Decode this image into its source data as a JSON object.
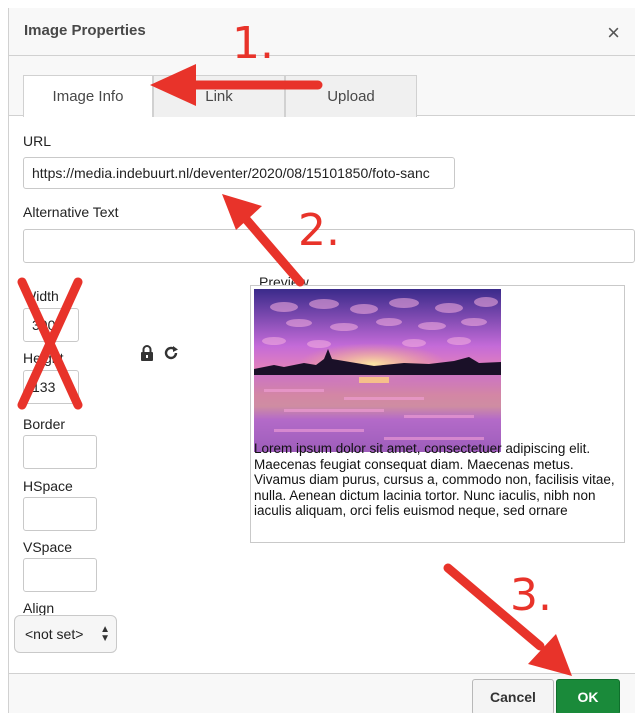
{
  "dialog": {
    "title": "Image Properties",
    "close_glyph": "×"
  },
  "tabs": [
    {
      "label": "Image Info",
      "active": true
    },
    {
      "label": "Link",
      "active": false
    },
    {
      "label": "Upload",
      "active": false
    }
  ],
  "form": {
    "url_label": "URL",
    "url_value": "https://media.indebuurt.nl/deventer/2020/08/15101850/foto-sanc",
    "alt_label": "Alternative Text",
    "alt_value": "",
    "width_label": "Width",
    "width_value": "300",
    "height_label": "Height",
    "height_value": "133",
    "border_label": "Border",
    "hspace_label": "HSpace",
    "vspace_label": "VSpace",
    "align_label": "Align",
    "align_value": "<not set>"
  },
  "preview": {
    "label": "Preview",
    "text": "Lorem ipsum dolor sit amet, consectetuer adipiscing elit. Maecenas feugiat consequat diam. Maecenas metus. Vivamus diam purus, cursus a, commodo non, facilisis vitae, nulla. Aenean dictum lacinia tortor. Nunc iaculis, nibh non iaculis aliquam, orci felis euismod neque, sed ornare"
  },
  "buttons": {
    "cancel_label": "Cancel",
    "ok_label": "OK"
  },
  "annotations": {
    "step1": "1.",
    "step2": "2.",
    "step3": "3."
  },
  "icons": [
    "close-icon",
    "lock-icon",
    "reset-icon",
    "select-arrows-icon"
  ],
  "colors": {
    "accent_ok": "#1a8a3a",
    "annotation_red": "#e8332a"
  }
}
